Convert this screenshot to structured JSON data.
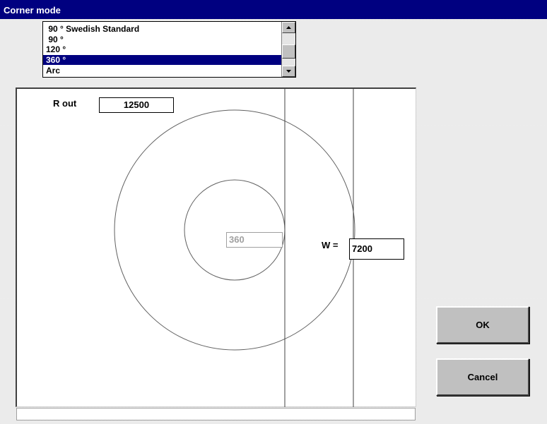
{
  "window": {
    "title": "Corner mode"
  },
  "corner_list": {
    "items": [
      {
        "label": " 90 ° Swedish Standard",
        "selected": false
      },
      {
        "label": " 90 °",
        "selected": false
      },
      {
        "label": "120 °",
        "selected": false
      },
      {
        "label": "360 °",
        "selected": true
      },
      {
        "label": "Arc",
        "selected": false
      }
    ]
  },
  "drawing": {
    "r_out_label": "R out",
    "r_out_value": "12500",
    "angle_value": "360",
    "width_label": "W =",
    "width_value": "7200"
  },
  "buttons": {
    "ok": "OK",
    "cancel": "Cancel"
  },
  "statusbar": {
    "text": ""
  }
}
